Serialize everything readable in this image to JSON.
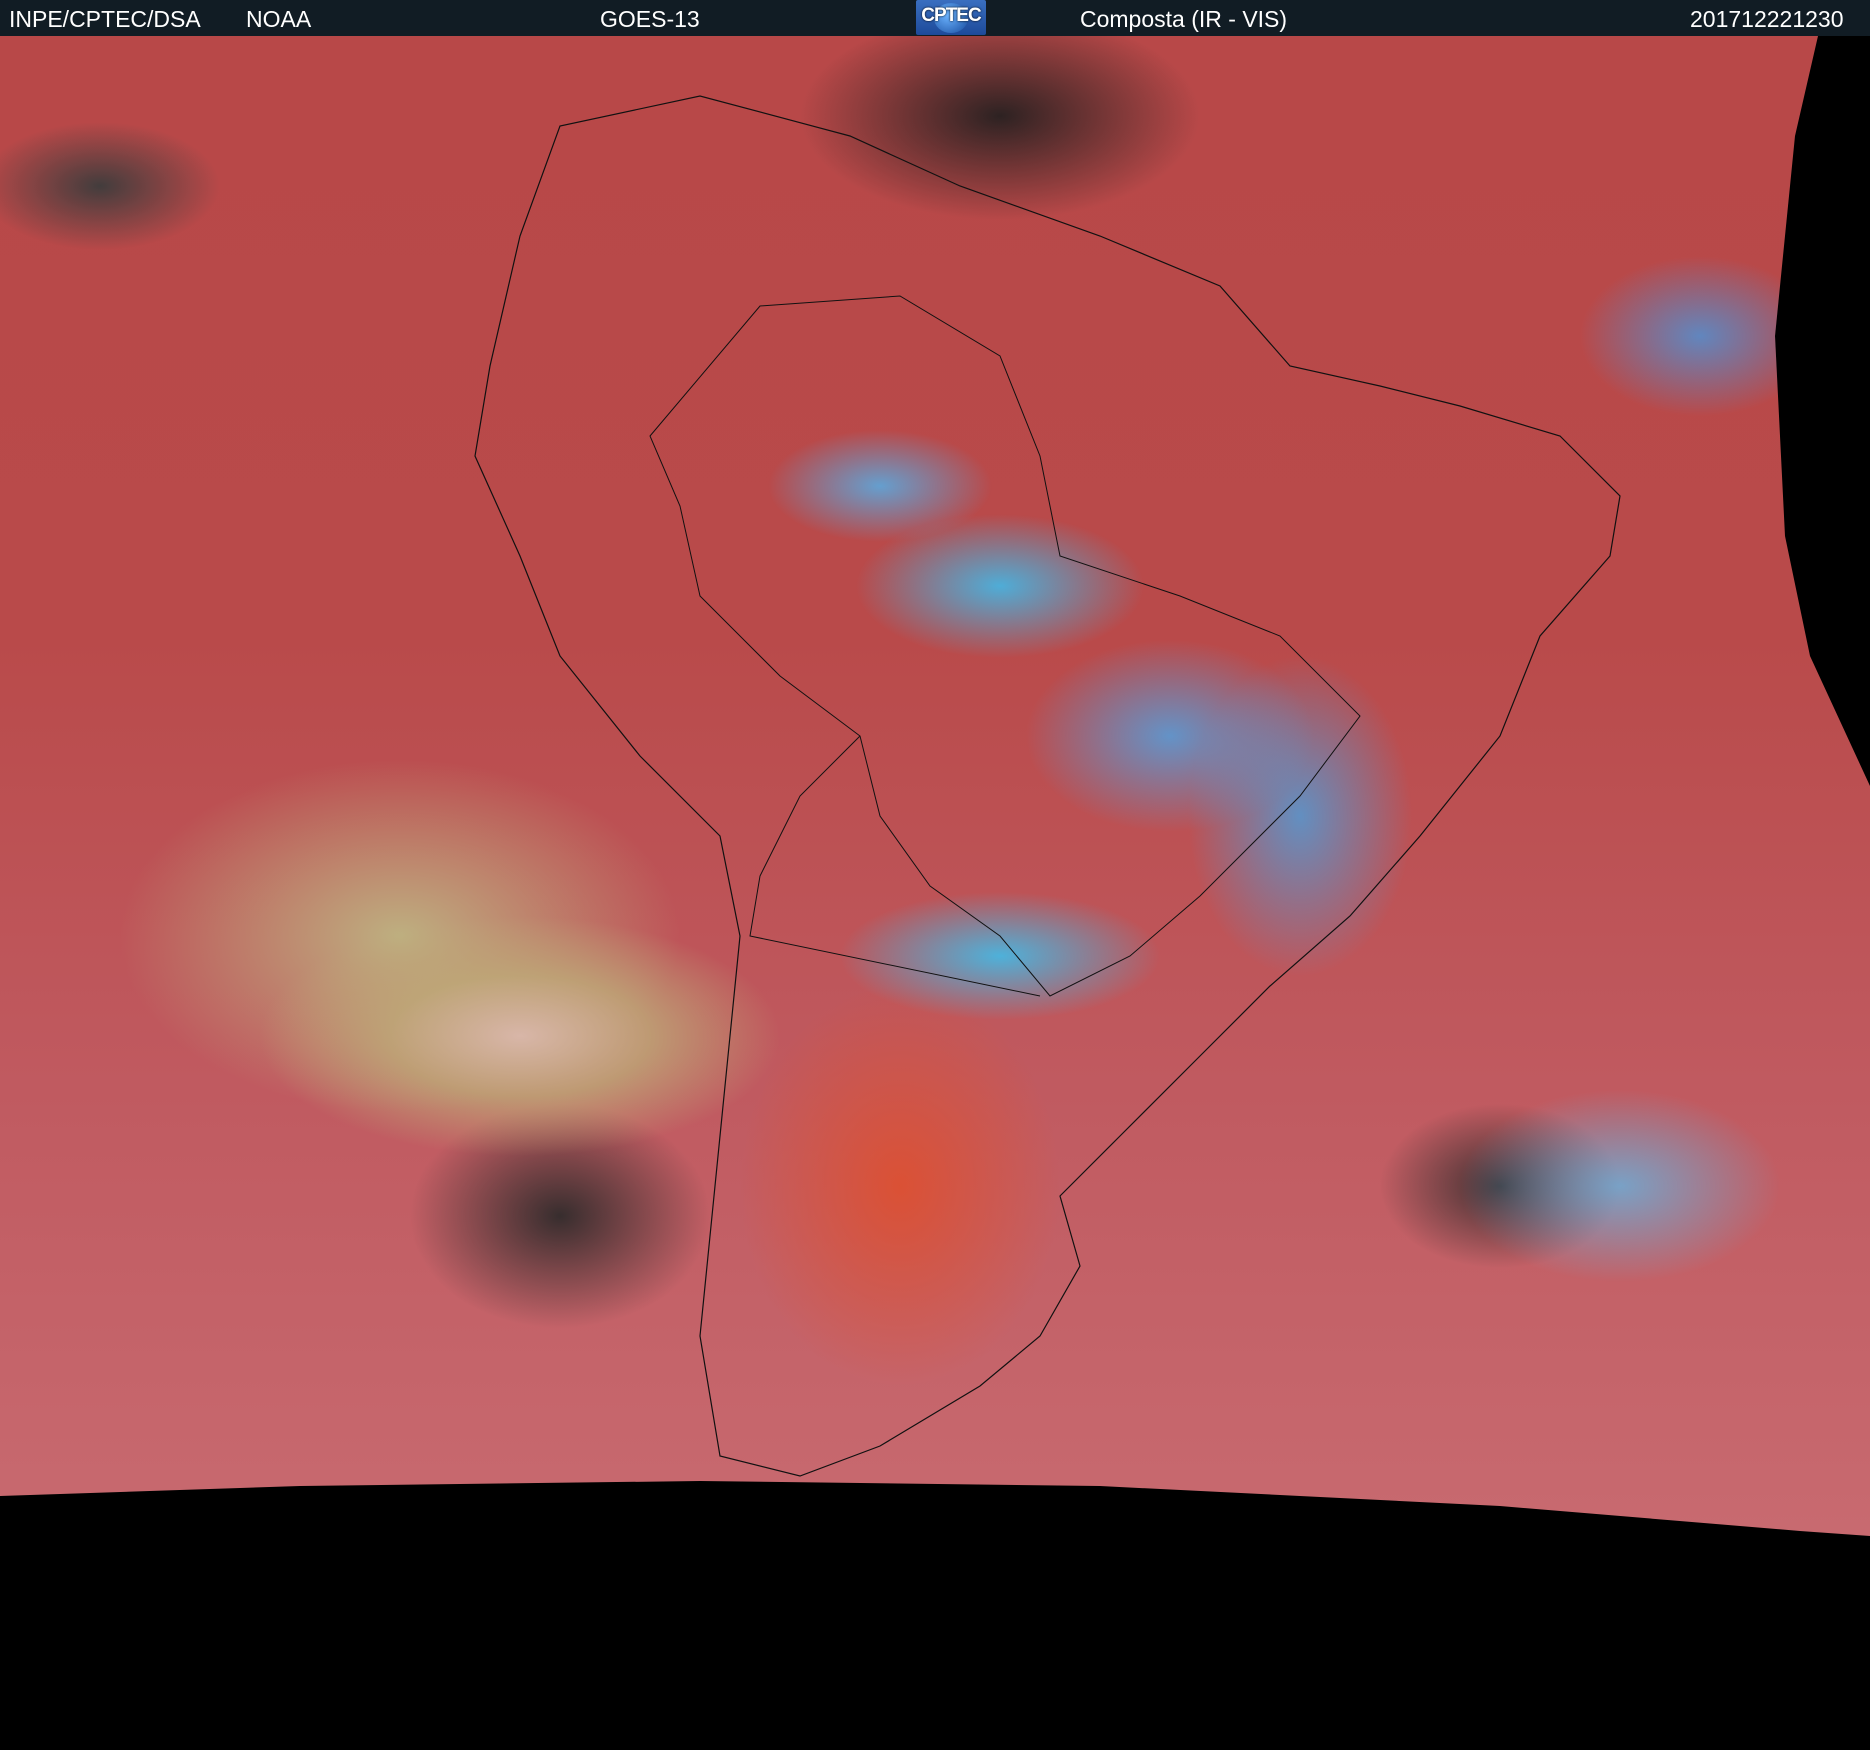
{
  "header": {
    "agency": "INPE/CPTEC/DSA",
    "partner": "NOAA",
    "satellite": "GOES-13",
    "logo_text": "CPTEC",
    "product": "Composta (IR - VIS)",
    "timestamp": "201712221230"
  },
  "colors": {
    "header_bg": "#111c24",
    "land": "#b84848",
    "cloud_high": "#3cbef0"
  }
}
